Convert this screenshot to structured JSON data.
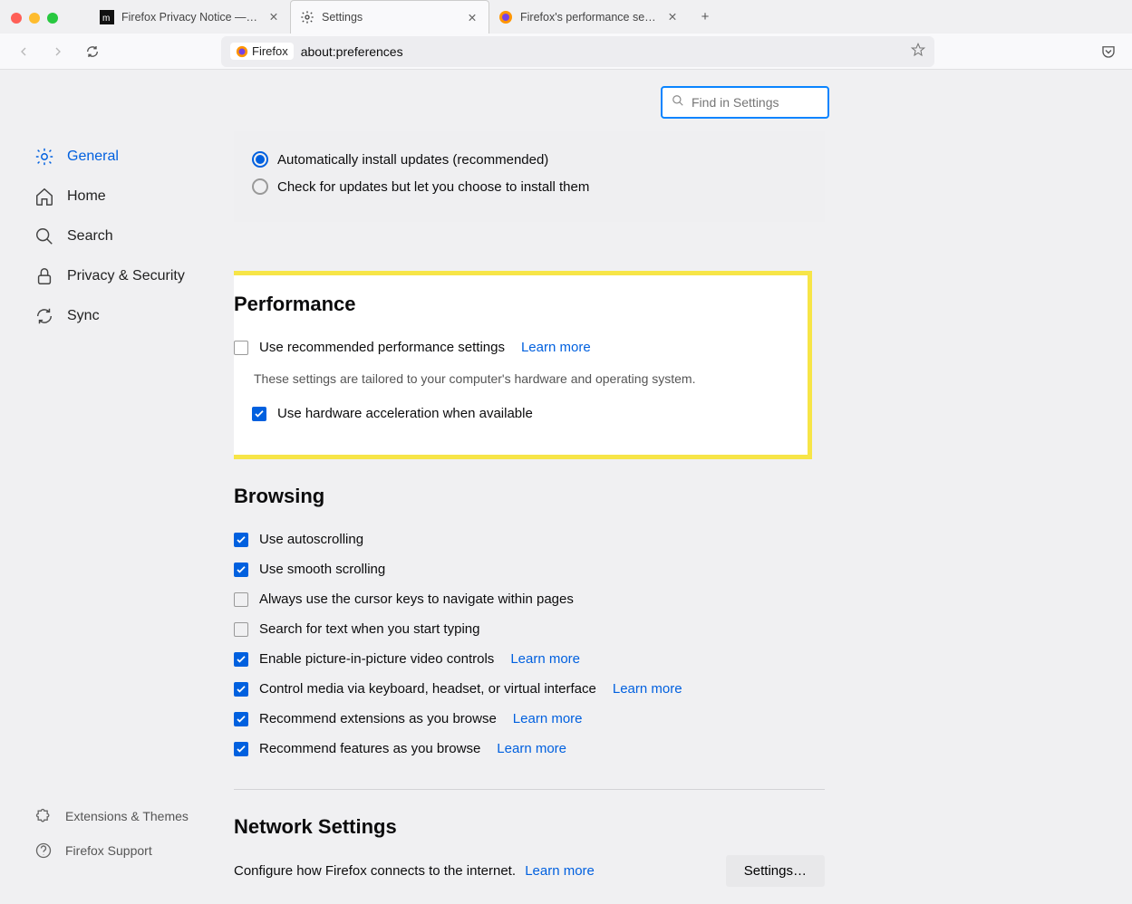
{
  "tabs": [
    {
      "label": "Firefox Privacy Notice — Mozilla"
    },
    {
      "label": "Settings"
    },
    {
      "label": "Firefox's performance settings"
    }
  ],
  "url": {
    "badge": "Firefox",
    "value": "about:preferences"
  },
  "search": {
    "placeholder": "Find in Settings"
  },
  "sidebar": [
    {
      "label": "General"
    },
    {
      "label": "Home"
    },
    {
      "label": "Search"
    },
    {
      "label": "Privacy & Security"
    },
    {
      "label": "Sync"
    }
  ],
  "sidebarBottom": [
    {
      "label": "Extensions & Themes"
    },
    {
      "label": "Firefox Support"
    }
  ],
  "updates": {
    "autoLabel": "Automatically install updates (recommended)",
    "checkLabel": "Check for updates but let you choose to install them"
  },
  "performance": {
    "title": "Performance",
    "recommended": "Use recommended performance settings",
    "learnMore": "Learn more",
    "hint": "These settings are tailored to your computer's hardware and operating system.",
    "hwAccel": "Use hardware acceleration when available"
  },
  "browsing": {
    "title": "Browsing",
    "items": [
      {
        "label": "Use autoscrolling",
        "checked": true,
        "learnMore": false
      },
      {
        "label": "Use smooth scrolling",
        "checked": true,
        "learnMore": false
      },
      {
        "label": "Always use the cursor keys to navigate within pages",
        "checked": false,
        "learnMore": false
      },
      {
        "label": "Search for text when you start typing",
        "checked": false,
        "learnMore": false
      },
      {
        "label": "Enable picture-in-picture video controls",
        "checked": true,
        "learnMore": true
      },
      {
        "label": "Control media via keyboard, headset, or virtual interface",
        "checked": true,
        "learnMore": true
      },
      {
        "label": "Recommend extensions as you browse",
        "checked": true,
        "learnMore": true
      },
      {
        "label": "Recommend features as you browse",
        "checked": true,
        "learnMore": true
      }
    ],
    "learnMoreText": "Learn more"
  },
  "network": {
    "title": "Network Settings",
    "desc": "Configure how Firefox connects to the internet.",
    "learnMore": "Learn more",
    "button": "Settings…"
  }
}
